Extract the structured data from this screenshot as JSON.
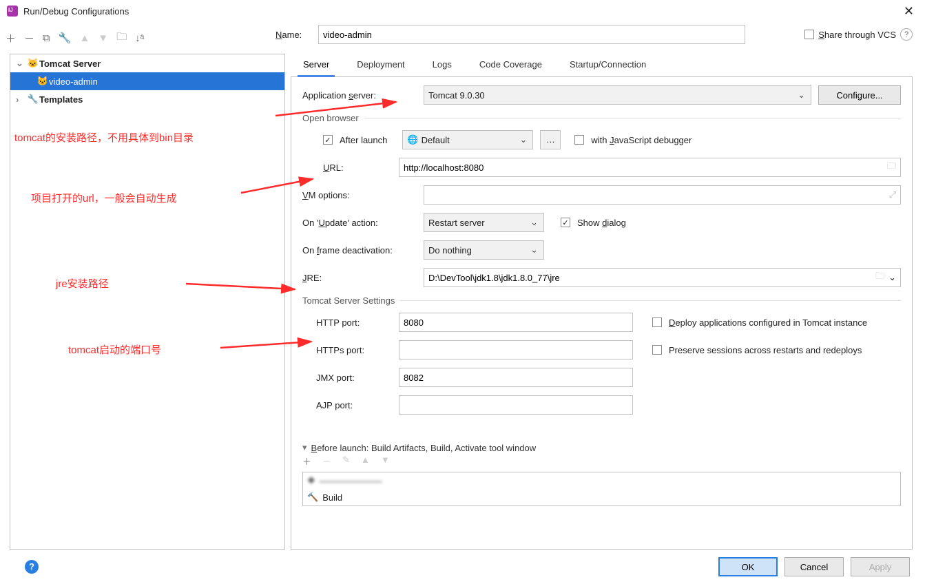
{
  "window": {
    "title": "Run/Debug Configurations"
  },
  "share": {
    "label": "Share through VCS"
  },
  "name_label": "Name:",
  "name_value": "video-admin",
  "tree": {
    "tomcat_server": "Tomcat Server",
    "video_admin": "video-admin",
    "templates": "Templates"
  },
  "tabs": {
    "server": "Server",
    "deployment": "Deployment",
    "logs": "Logs",
    "coverage": "Code Coverage",
    "startup": "Startup/Connection"
  },
  "labels": {
    "app_server": "Application server:",
    "configure": "Configure...",
    "open_browser": "Open browser",
    "after_launch": "After launch",
    "default": "Default",
    "with_js": "with JavaScript debugger",
    "url": "URL:",
    "vm_options": "VM options:",
    "on_update": "On 'Update' action:",
    "show_dialog": "Show dialog",
    "on_frame": "On frame deactivation:",
    "jre": "JRE:",
    "tomcat_settings": "Tomcat Server Settings",
    "http_port": "HTTP port:",
    "https_port": "HTTPs port:",
    "jmx_port": "JMX port:",
    "ajp_port": "AJP port:",
    "deploy_apps": "Deploy applications configured in Tomcat instance",
    "preserve": "Preserve sessions across restarts and redeploys",
    "before_launch": "Before launch: Build Artifacts, Build, Activate tool window",
    "build": "Build"
  },
  "values": {
    "app_server": "Tomcat 9.0.30",
    "url": "http://localhost:8080",
    "on_update": "Restart server",
    "on_frame": "Do nothing",
    "jre": "D:\\DevTool\\jdk1.8\\jdk1.8.0_77\\jre",
    "http_port": "8080",
    "https_port": "",
    "jmx_port": "8082",
    "ajp_port": ""
  },
  "footer": {
    "ok": "OK",
    "cancel": "Cancel",
    "apply": "Apply"
  },
  "annotations": {
    "a1": "tomcat的安装路径，不用具体到bin目录",
    "a2": "项目打开的url，一般会自动生成",
    "a3": "jre安装路径",
    "a4": "tomcat启动的端口号"
  }
}
